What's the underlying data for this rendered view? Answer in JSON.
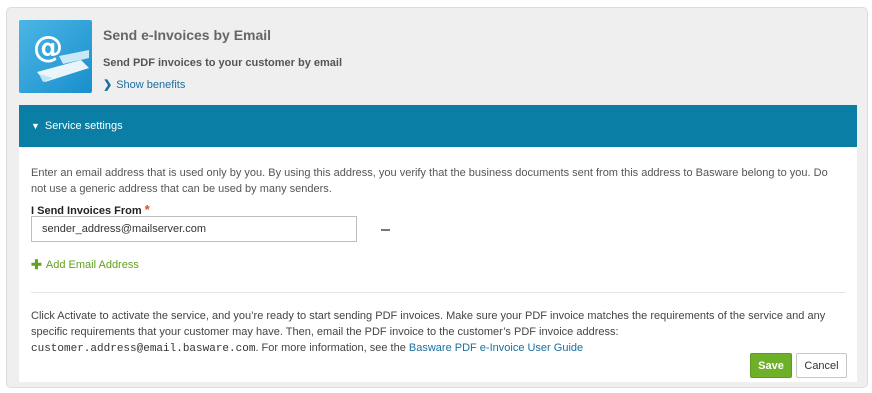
{
  "header": {
    "title": "Send e-Invoices by Email",
    "subtitle": "Send PDF invoices to your customer by email",
    "benefits_link": "Show benefits",
    "tile_icon": "email-at-icon",
    "tile_glyph": "@"
  },
  "service_settings": {
    "label": "Service settings",
    "description": "Enter an email address that is used only by you. By using this address, you verify that the business documents sent from this address to Basware belong to you. Do not use a generic address that can be used by many senders.",
    "field_label": "I Send Invoices From",
    "required_mark": "*",
    "email_value": "sender_address@mailserver.com",
    "add_email_label": "Add Email Address",
    "activate_text_1": "Click Activate to activate the service, and you’re ready to start sending PDF invoices. Make sure your PDF invoice matches the requirements of the service and any specific requirements that your customer may have. Then, email the PDF invoice to the customer’s PDF invoice address: ",
    "customer_address": "customer.address@email.basware.com",
    "activate_text_2": ". For more information, see the ",
    "guide_link": "Basware PDF e-Invoice User Guide"
  },
  "actions": {
    "save_label": "Save",
    "cancel_label": "Cancel"
  },
  "colors": {
    "accent_bar": "#0a7ea4",
    "save_green": "#6fb02a",
    "link_blue": "#1a6fa0",
    "add_green": "#62a01e",
    "required_orange": "#e0501a"
  }
}
